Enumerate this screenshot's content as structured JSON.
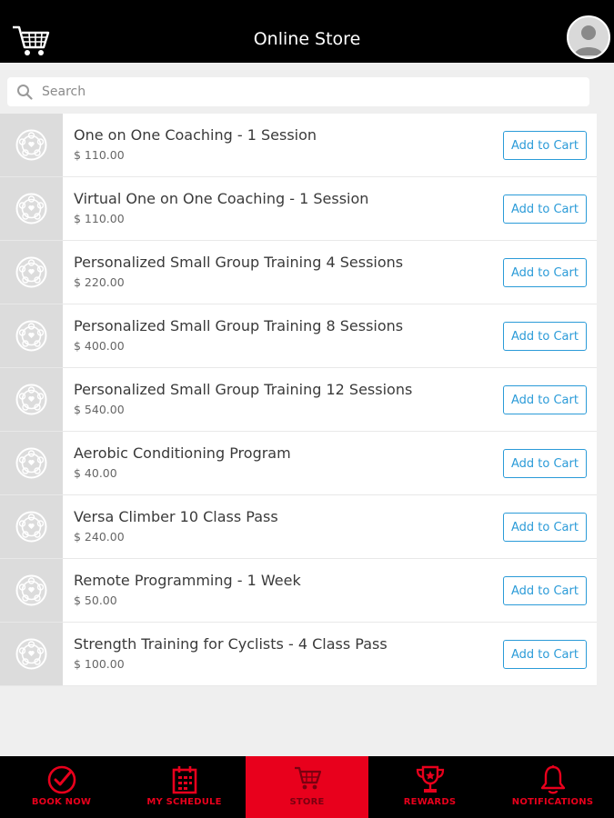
{
  "header": {
    "title": "Online Store",
    "cart_icon": "shopping-cart-icon",
    "avatar_icon": "user-avatar-icon"
  },
  "search": {
    "placeholder": "Search",
    "value": "",
    "icon": "search-icon"
  },
  "colors": {
    "header_bg": "#000000",
    "accent_red": "#e8001c",
    "button_blue": "#2b9bd8",
    "page_bg": "#efefef"
  },
  "products": [
    {
      "name": "One on One Coaching - 1 Session",
      "price": "$ 110.00",
      "button": "Add to Cart"
    },
    {
      "name": "Virtual One on One Coaching - 1 Session",
      "price": "$ 110.00",
      "button": "Add to Cart"
    },
    {
      "name": "Personalized Small Group Training 4 Sessions",
      "price": "$ 220.00",
      "button": "Add to Cart"
    },
    {
      "name": "Personalized Small Group Training 8 Sessions",
      "price": "$ 400.00",
      "button": "Add to Cart"
    },
    {
      "name": "Personalized Small Group Training 12 Sessions",
      "price": "$ 540.00",
      "button": "Add to Cart"
    },
    {
      "name": "Aerobic Conditioning Program",
      "price": "$ 40.00",
      "button": "Add to Cart"
    },
    {
      "name": "Versa Climber 10 Class Pass",
      "price": "$ 240.00",
      "button": "Add to Cart"
    },
    {
      "name": "Remote Programming - 1 Week",
      "price": "$ 50.00",
      "button": "Add to Cart"
    },
    {
      "name": "Strength Training for Cyclists - 4 Class Pass",
      "price": "$ 100.00",
      "button": "Add to Cart"
    }
  ],
  "bottom_nav": [
    {
      "label": "BOOK NOW",
      "icon": "check-circle-icon",
      "active": false
    },
    {
      "label": "MY SCHEDULE",
      "icon": "calendar-icon",
      "active": false
    },
    {
      "label": "STORE",
      "icon": "shopping-cart-icon",
      "active": true
    },
    {
      "label": "REWARDS",
      "icon": "trophy-icon",
      "active": false
    },
    {
      "label": "NOTIFICATIONS",
      "icon": "bell-icon",
      "active": false
    }
  ]
}
